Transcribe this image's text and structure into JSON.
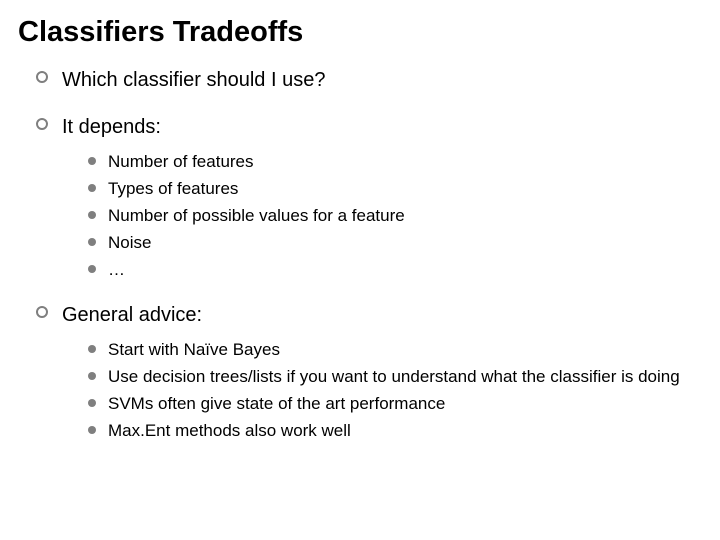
{
  "title": "Classifiers Tradeoffs",
  "items": [
    {
      "label": "Which classifier should I use?"
    },
    {
      "label": "It depends:",
      "sub": [
        "Number of features",
        "Types of features",
        "Number of possible values for a feature",
        "Noise",
        "…"
      ]
    },
    {
      "label": "General advice:",
      "sub": [
        "Start with Naïve Bayes",
        "Use decision trees/lists if you want to understand what the classifier is doing",
        "SVMs often give state of the art performance",
        "Max.Ent methods also work well"
      ]
    }
  ]
}
